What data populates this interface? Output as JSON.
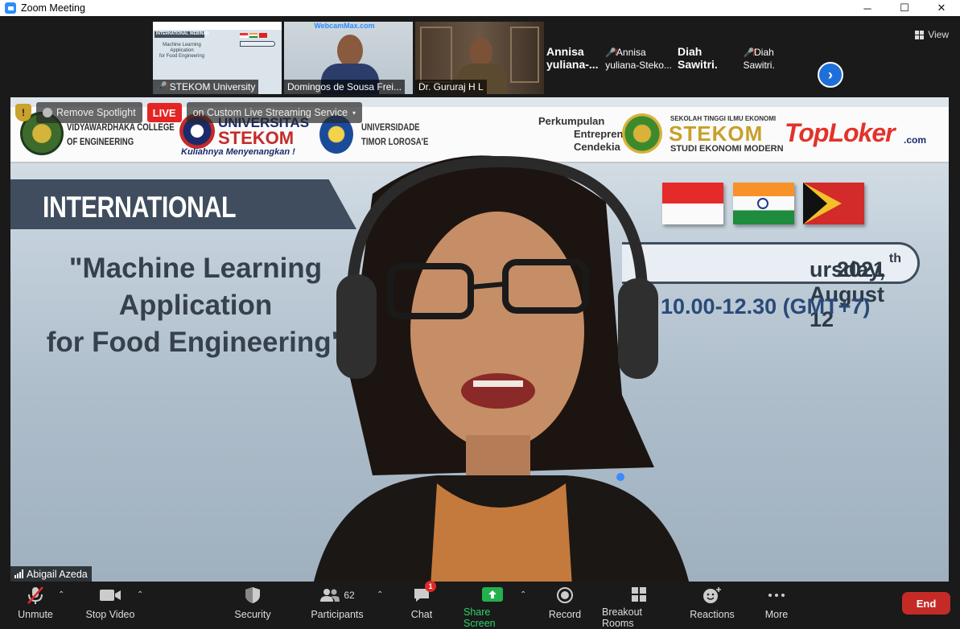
{
  "window": {
    "title": "Zoom Meeting",
    "minimize": "─",
    "maximize": "☐",
    "close": "✕"
  },
  "thumbnails": [
    {
      "name": "STEKOM University",
      "muted": true,
      "slide_lines": [
        "INTERNATIONAL WEBINAR",
        "Machine Learning",
        "Application",
        "for Food Engineering"
      ]
    },
    {
      "name": "Domingos de Sousa Frei...",
      "muted": false,
      "overlay": "WebcamMax.com"
    },
    {
      "name": "Dr. Gururaj H L",
      "muted": false
    },
    {
      "name": "Annisa yuliana-Steko...",
      "muted": true,
      "display": "Annisa  yuliana-..."
    },
    {
      "name": "Diah Sawitri.",
      "muted": true,
      "display": "Diah Sawitri."
    }
  ],
  "view_button": {
    "label": "View"
  },
  "stage": {
    "remove_spotlight": "Remove Spotlight",
    "live_badge": "LIVE",
    "streaming": "on Custom Live Streaming Service",
    "speaker": "Abigail Azeda",
    "slide": {
      "logos": [
        "VIDYAWARDHAKA COLLEGE",
        "OF ENGINEERING",
        "UNIVERSITAS",
        "STEKOM",
        "Kuliahnya Menyenangkan !",
        "UNIVERSIDADE",
        "TIMOR LOROSA'E",
        "Perkumpulan",
        "Entrepreneur",
        "Cendekia",
        "SEKOLAH TINGGI ILMU EKONOMI",
        "STEKOM",
        "STUDI EKONOMI MODERN",
        "TopLoker",
        ".com"
      ],
      "banner": "INTERNATIONAL WEBINAR",
      "title_lines": [
        "\"Machine Learning",
        "Application",
        "for Food Engineering\""
      ],
      "date": "ursday, August 12",
      "date_sup": "th",
      "date_year": " 2021",
      "time": "10.00-12.30 (GMT+7)"
    }
  },
  "toolbar": {
    "unmute": "Unmute",
    "stop_video": "Stop Video",
    "security": "Security",
    "participants": "Participants",
    "participants_count": "62",
    "chat": "Chat",
    "chat_badge": "1",
    "share_screen": "Share Screen",
    "record": "Record",
    "breakout_rooms": "Breakout Rooms",
    "reactions": "Reactions",
    "more": "More",
    "end": "End"
  },
  "colors": {
    "live": "#e32524",
    "share_green": "#23b14d",
    "end_red": "#c42b27",
    "accent_blue": "#1e6fd9"
  }
}
